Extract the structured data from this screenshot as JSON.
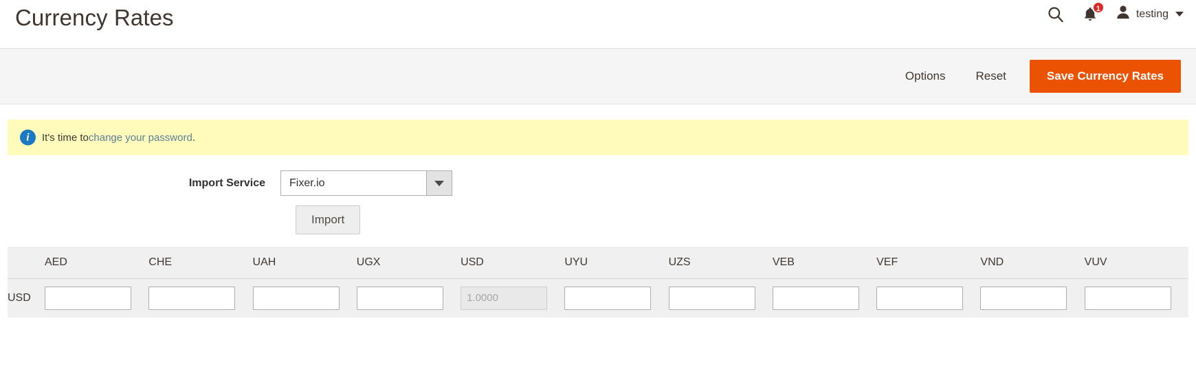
{
  "header": {
    "title": "Currency Rates",
    "search_icon": "search-icon",
    "notifications_icon": "bell-icon",
    "notifications_count": "1",
    "user_icon": "user-avatar-icon",
    "user_name": "testing",
    "user_caret_icon": "caret-down-icon"
  },
  "page_actions": {
    "options_label": "Options",
    "reset_label": "Reset",
    "save_label": "Save Currency Rates",
    "primary_color": "#eb5202"
  },
  "message": {
    "icon": "info-icon",
    "text_before": "It's time to ",
    "link_text": "change your password",
    "text_after": ".",
    "background": "#fffbbb",
    "link_color": "#5a7f9a"
  },
  "import_form": {
    "service_label": "Import Service",
    "service_value": "Fixer.io",
    "service_arrow_icon": "chevron-down-icon",
    "import_button_label": "Import"
  },
  "rates_table": {
    "columns": [
      "AED",
      "CHE",
      "UAH",
      "UGX",
      "USD",
      "UYU",
      "UZS",
      "VEB",
      "VEF",
      "VND",
      "VUV"
    ],
    "rows": [
      {
        "label": "USD",
        "cells": [
          {
            "value": "",
            "disabled": false
          },
          {
            "value": "",
            "disabled": false
          },
          {
            "value": "",
            "disabled": false
          },
          {
            "value": "",
            "disabled": false
          },
          {
            "value": "1.0000",
            "disabled": true
          },
          {
            "value": "",
            "disabled": false
          },
          {
            "value": "",
            "disabled": false
          },
          {
            "value": "",
            "disabled": false
          },
          {
            "value": "",
            "disabled": false
          },
          {
            "value": "",
            "disabled": false
          },
          {
            "value": "",
            "disabled": false
          }
        ]
      }
    ]
  }
}
